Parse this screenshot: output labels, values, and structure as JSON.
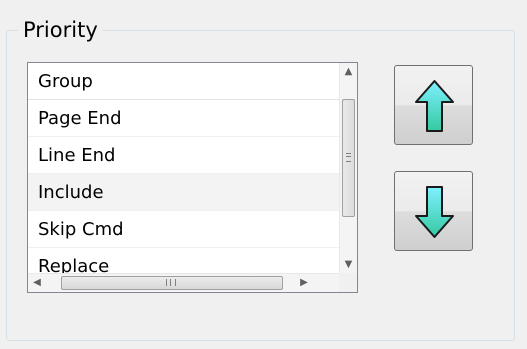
{
  "groupbox": {
    "title": "Priority"
  },
  "list": {
    "header": "Group",
    "items": [
      "Page End",
      "Line End",
      "Include",
      "Skip Cmd",
      "Replace"
    ]
  },
  "scrollbars": {
    "up_glyph": "▲",
    "down_glyph": "▼",
    "left_glyph": "◀",
    "right_glyph": "▶"
  },
  "buttons": {
    "move_up_icon": "arrow-up-icon",
    "move_down_icon": "arrow-down-icon",
    "arrow_fill_top": "#7ff0ff",
    "arrow_fill_bottom": "#35c9a0"
  }
}
